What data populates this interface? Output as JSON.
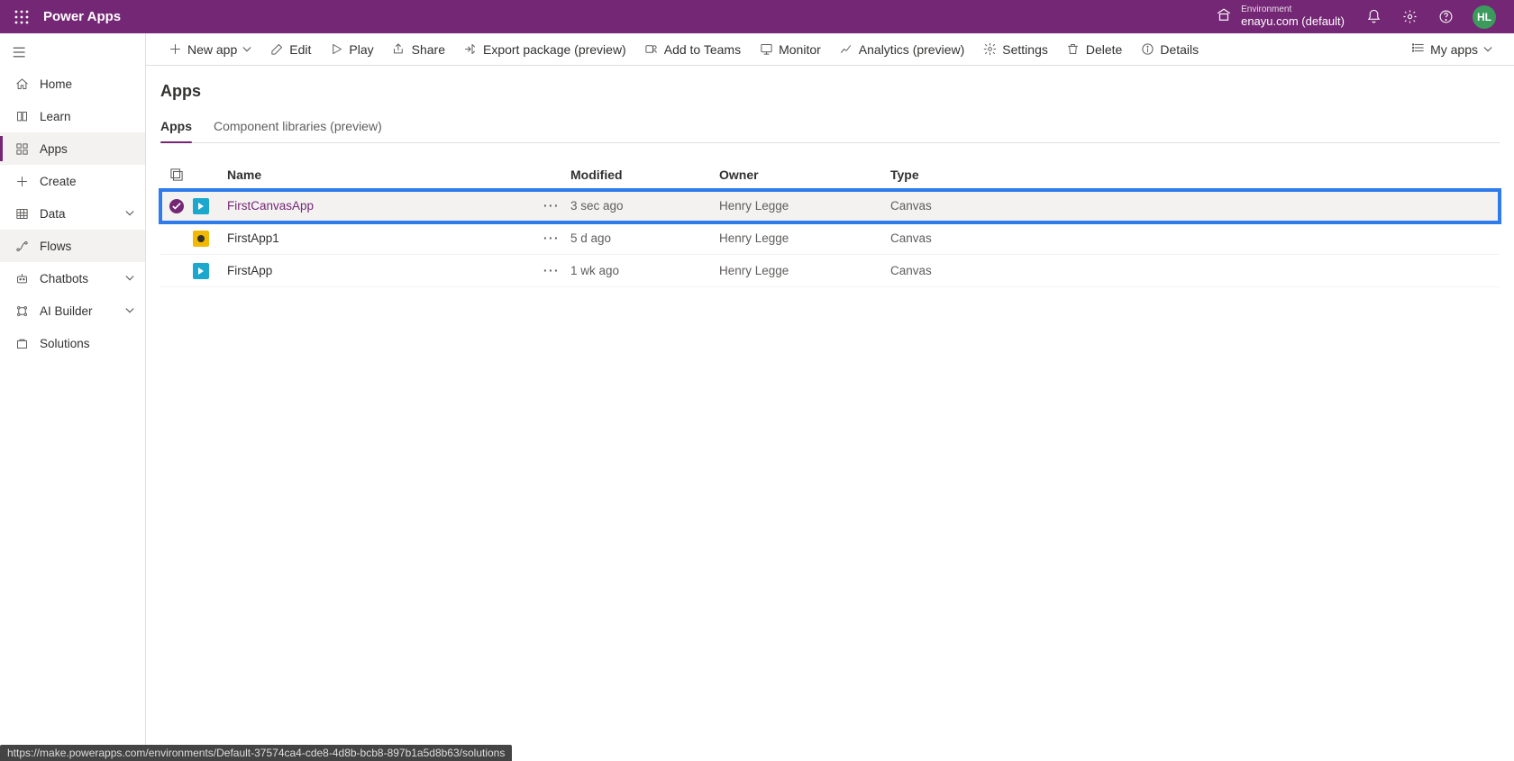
{
  "header": {
    "brand": "Power Apps",
    "environment_label": "Environment",
    "environment_name": "enayu.com (default)",
    "avatar_initials": "HL"
  },
  "sidebar": {
    "items": [
      {
        "label": "Home",
        "icon": "home"
      },
      {
        "label": "Learn",
        "icon": "book"
      },
      {
        "label": "Apps",
        "icon": "apps",
        "active": true
      },
      {
        "label": "Create",
        "icon": "plus"
      },
      {
        "label": "Data",
        "icon": "grid",
        "chevron": true
      },
      {
        "label": "Flows",
        "icon": "flow",
        "hover": true
      },
      {
        "label": "Chatbots",
        "icon": "bot",
        "chevron": true
      },
      {
        "label": "AI Builder",
        "icon": "ai",
        "chevron": true
      },
      {
        "label": "Solutions",
        "icon": "solutions"
      }
    ]
  },
  "commandbar": {
    "items": [
      {
        "label": "New app",
        "icon": "plus",
        "dropdown": true,
        "name": "cmd-new-app"
      },
      {
        "label": "Edit",
        "icon": "pencil",
        "name": "cmd-edit"
      },
      {
        "label": "Play",
        "icon": "play",
        "name": "cmd-play"
      },
      {
        "label": "Share",
        "icon": "share",
        "name": "cmd-share"
      },
      {
        "label": "Export package (preview)",
        "icon": "export",
        "name": "cmd-export"
      },
      {
        "label": "Add to Teams",
        "icon": "teams",
        "name": "cmd-add-teams"
      },
      {
        "label": "Monitor",
        "icon": "monitor",
        "name": "cmd-monitor"
      },
      {
        "label": "Analytics (preview)",
        "icon": "analytics",
        "name": "cmd-analytics"
      },
      {
        "label": "Settings",
        "icon": "gear",
        "name": "cmd-settings"
      },
      {
        "label": "Delete",
        "icon": "trash",
        "name": "cmd-delete"
      },
      {
        "label": "Details",
        "icon": "info",
        "name": "cmd-details"
      }
    ],
    "right": {
      "label": "My apps",
      "icon": "list"
    }
  },
  "page": {
    "title": "Apps",
    "tabs": [
      {
        "label": "Apps",
        "active": true
      },
      {
        "label": "Component libraries (preview)"
      }
    ],
    "columns": {
      "name": "Name",
      "modified": "Modified",
      "owner": "Owner",
      "type": "Type"
    },
    "rows": [
      {
        "name": "FirstCanvasApp",
        "modified": "3 sec ago",
        "owner": "Henry Legge",
        "type": "Canvas",
        "iconColor": "teal",
        "selected": true,
        "highlight": true
      },
      {
        "name": "FirstApp1",
        "modified": "5 d ago",
        "owner": "Henry Legge",
        "type": "Canvas",
        "iconColor": "amber"
      },
      {
        "name": "FirstApp",
        "modified": "1 wk ago",
        "owner": "Henry Legge",
        "type": "Canvas",
        "iconColor": "teal"
      }
    ]
  },
  "status_url": "https://make.powerapps.com/environments/Default-37574ca4-cde8-4d8b-bcb8-897b1a5d8b63/solutions"
}
